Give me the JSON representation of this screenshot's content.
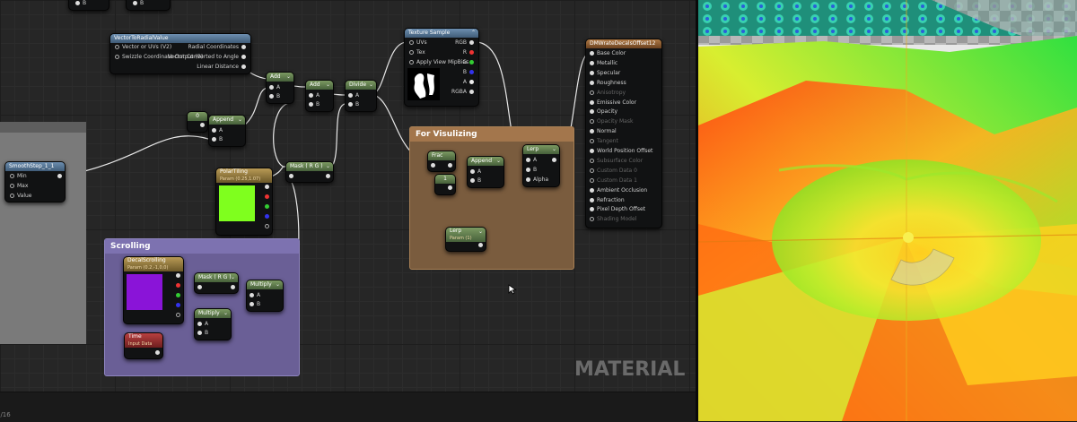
{
  "nodes": {
    "vector_to_radial": {
      "title": "VectorToRadialValue",
      "in_pins": [
        "Vector or UVs (V2)",
        "Swizzle Coordinate Output (B)"
      ],
      "out_pins": [
        "Radial Coordinates",
        "Vector Converted to Angle",
        "Linear Distance"
      ]
    },
    "add1": {
      "title": "Add",
      "a": "A",
      "b": "B"
    },
    "add2": {
      "title": "Add",
      "a": "A",
      "b": "B"
    },
    "divide": {
      "title": "Divide",
      "a": "A",
      "b": "B"
    },
    "texture_sample": {
      "title": "Texture Sample",
      "in_pins": [
        "UVs",
        "Tex",
        "Apply View MipBias"
      ],
      "out_pins": [
        "RGB",
        "R",
        "G",
        "B",
        "A",
        "RGBA"
      ]
    },
    "material_output": {
      "title": "DMWrateDecalsOffset12",
      "pins": [
        "Base Color",
        "Metallic",
        "Specular",
        "Roughness",
        "Anisotropy",
        "Emissive Color",
        "Opacity",
        "Opacity Mask",
        "Normal",
        "Tangent",
        "World Position Offset",
        "Subsurface Color",
        "Custom Data 0",
        "Custom Data 1",
        "Ambient Occlusion",
        "Refraction",
        "Pixel Depth Offset",
        "Shading Model"
      ]
    },
    "const0": {
      "value": "0"
    },
    "append1": {
      "title": "Append",
      "a": "A",
      "b": "B"
    },
    "smoothstep": {
      "title": "SmoothStep_1_1",
      "pins": [
        "Min",
        "Max",
        "Value"
      ]
    },
    "polar_tiling": {
      "title": "PolarTiling",
      "subtitle": "Param (0.25,1.07)"
    },
    "mask1": {
      "title": "Mask ( R G )"
    },
    "frac": {
      "title": "Frac"
    },
    "one": {
      "title": "1"
    },
    "append2": {
      "title": "Append",
      "a": "A",
      "b": "B"
    },
    "lerp1": {
      "title": "Lerp",
      "a": "A",
      "b": "B",
      "alpha": "Alpha"
    },
    "lerp2": {
      "title": "Lerp",
      "subtitle": "Param (1)"
    },
    "decal_scrolling": {
      "title": "DecalScrolling",
      "subtitle": "Param (0.2,-1,0,0)"
    },
    "mask2": {
      "title": "Mask ( R G )"
    },
    "multiply1": {
      "title": "Multiply",
      "a": "A",
      "b": "B"
    },
    "multiply2": {
      "title": "Multiply",
      "a": "A",
      "b": "B"
    },
    "time": {
      "title": "Time",
      "subtitle": "Input Data"
    }
  },
  "comments": {
    "scrolling": "Scrolling",
    "visualizing": "For Visulizing"
  },
  "watermark": "MATERIAL",
  "status_text": "5/16",
  "colors": {
    "polar_swatch": "#7fff1e",
    "decal_swatch": "#8a14d8",
    "scroll_box": "#6a5f96",
    "vis_box": "#8a6848"
  }
}
